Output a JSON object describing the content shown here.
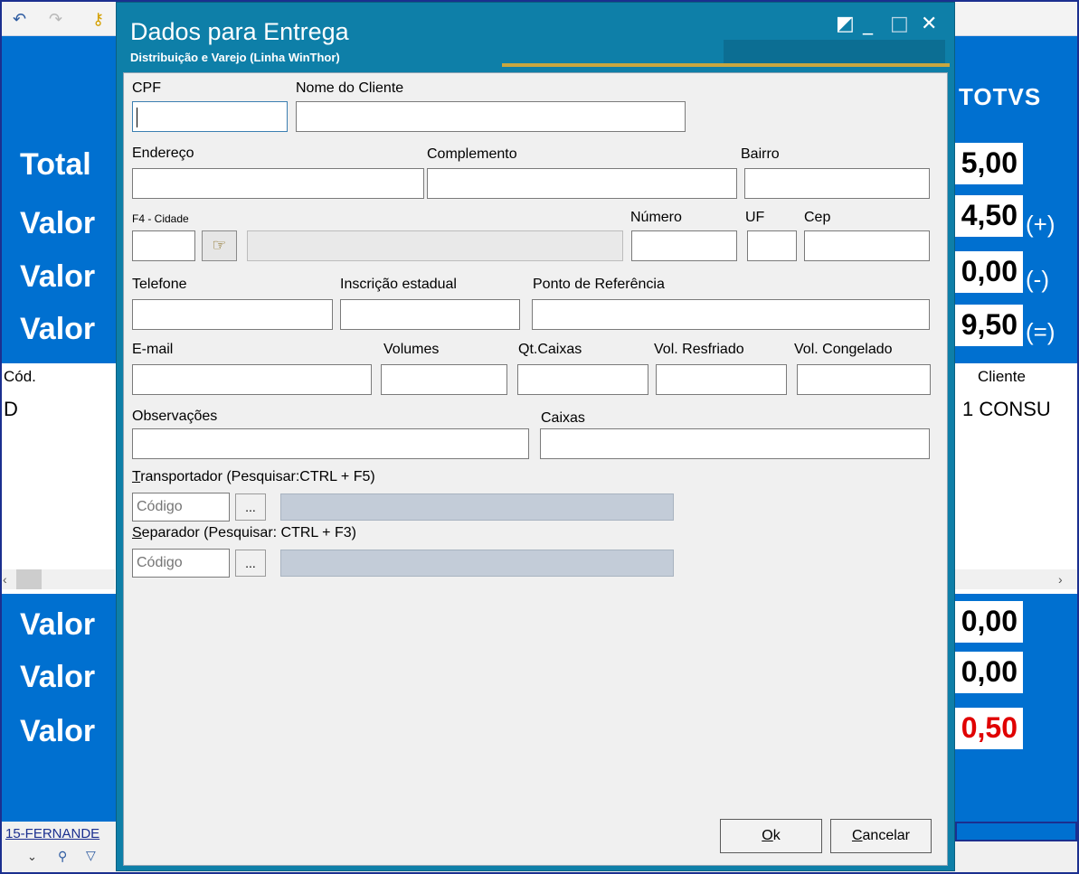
{
  "background": {
    "valor_labels": {
      "total": "Total",
      "valor1": "Valor",
      "valor2": "Valor",
      "valor3": "Valor",
      "valor4": "Valor",
      "valor5": "Valor",
      "valor6": "Valor"
    },
    "amounts": [
      "5,00",
      "4,50",
      "0,00",
      "9,50",
      "0,00",
      "0,00",
      "0,50"
    ],
    "signs": [
      "(+)",
      "(-)",
      "(=)"
    ],
    "logo": "TOTVS",
    "grid": {
      "col_cod_header": "Cód.",
      "col_cliente_header": "Cliente",
      "row_cod_value": "D",
      "row_cliente_value": "1 CONSU"
    },
    "status_text": "15-FERNANDE",
    "colors": {
      "background_blue": "#0070d0",
      "dialog_teal": "#0e7fa8",
      "highlight_red": "#e00000"
    }
  },
  "dialog": {
    "title": "Dados para Entrega",
    "subtitle": "Distribuição e Varejo (Linha WinThor)",
    "window_buttons": {
      "restore": "◩",
      "minimize": "_",
      "maximize": "□",
      "close": "✕"
    },
    "labels": {
      "cpf": "CPF",
      "nome_cliente": "Nome do Cliente",
      "endereco": "Endereço",
      "complemento": "Complemento",
      "bairro": "Bairro",
      "cidade": "F4 - Cidade",
      "numero": "Número",
      "uf": "UF",
      "cep": "Cep",
      "telefone": "Telefone",
      "inscricao": "Inscrição estadual",
      "referencia": "Ponto de Referência",
      "email": "E-mail",
      "volumes": "Volumes",
      "qt_caixas": "Qt.Caixas",
      "vol_resfriado": "Vol. Resfriado",
      "vol_congelado": "Vol. Congelado",
      "observacoes": "Observações",
      "caixas": "Caixas",
      "transportador_key": "T",
      "transportador_rest": "ransportador (Pesquisar:CTRL + F5)",
      "separador_key": "S",
      "separador_rest": "eparador (Pesquisar: CTRL + F3)"
    },
    "placeholders": {
      "transportador_codigo": "Código",
      "separador_codigo": "Código"
    },
    "dots_label": "...",
    "buttons": {
      "ok_key": "O",
      "ok_rest": "k",
      "cancel_key": "C",
      "cancel_rest": "ancelar"
    }
  }
}
